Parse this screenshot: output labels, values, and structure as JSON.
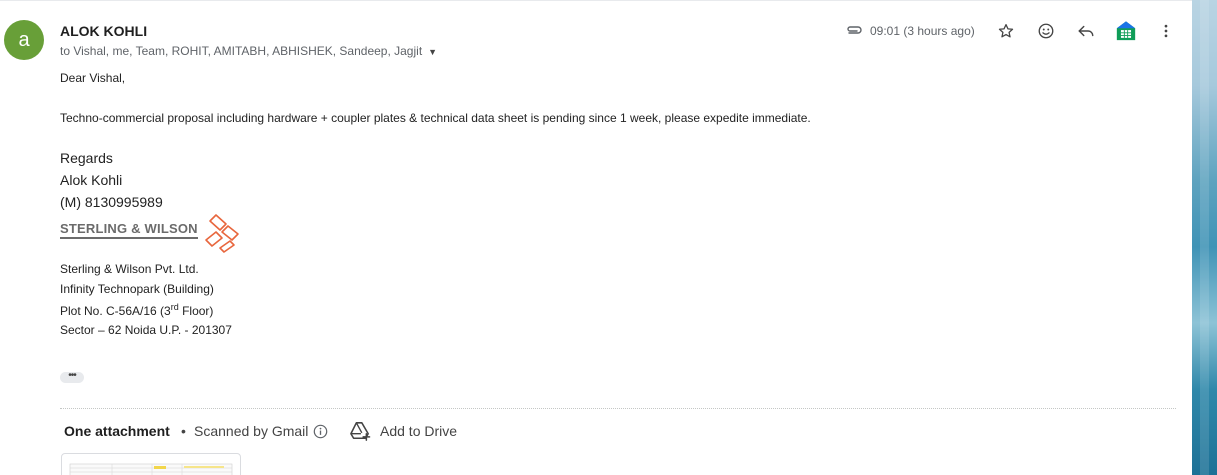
{
  "email": {
    "avatar_letter": "a",
    "avatar_color": "#689f38",
    "sender": "ALOK KOHLI",
    "recipients": "to Vishal, me, Team, ROHIT, AMITABH, ABHISHEK, Sandeep, Jagjit",
    "time": "09:01 (3 hours ago)",
    "greeting": "Dear Vishal,",
    "body": "Techno-commercial proposal including hardware + coupler plates & technical data sheet is pending since 1 week, please expedite immediate."
  },
  "signature": {
    "regards": "Regards",
    "name": "Alok Kohli",
    "mobile": "(M) 8130995989",
    "logo_text": "STERLING & WILSON",
    "company": "Sterling & Wilson Pvt. Ltd.",
    "building": "Infinity Technopark (Building)",
    "plot_prefix": "Plot No. C-56A/16 (3",
    "plot_sup": "rd",
    "plot_suffix": " Floor)",
    "sector": "Sector – 62 Noida U.P. - 201307"
  },
  "attachments": {
    "title": "One attachment",
    "separator": "•",
    "scanned": "Scanned by Gmail",
    "add_to_drive": "Add to Drive"
  },
  "icons": {
    "attachment": "paperclip-icon",
    "star": "star-icon",
    "emoji": "emoji-icon",
    "reply": "reply-icon",
    "sheets_addon": "sheets-icon",
    "more": "more-vert-icon",
    "info": "info-icon",
    "drive": "add-to-drive-icon"
  },
  "colors": {
    "logo_orange": "#e8663d",
    "sheets_green": "#0f9d58",
    "sheets_blue": "#1a73e8"
  }
}
